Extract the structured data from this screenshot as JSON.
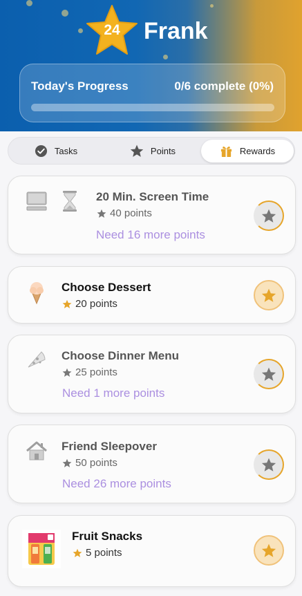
{
  "profile": {
    "level": "24",
    "name": "Frank"
  },
  "progress": {
    "label": "Today's Progress",
    "count_text": "0/6 complete (0%)",
    "fraction": 0
  },
  "tabs": [
    {
      "label": "Tasks",
      "icon": "check-circle-icon"
    },
    {
      "label": "Points",
      "icon": "star-icon"
    },
    {
      "label": "Rewards",
      "icon": "gift-icon",
      "active": true
    }
  ],
  "rewards": [
    {
      "title": "20 Min. Screen Time",
      "points": "40 points",
      "need": "Need 16 more points",
      "icons": [
        "computer-icon",
        "hourglass-icon"
      ],
      "locked": true
    },
    {
      "title": "Choose Dessert",
      "points": "20 points",
      "need": "",
      "icons": [
        "ice-cream-icon"
      ],
      "locked": false
    },
    {
      "title": "Choose Dinner Menu",
      "points": "25 points",
      "need": "Need 1 more points",
      "icons": [
        "pizza-icon"
      ],
      "locked": true
    },
    {
      "title": "Friend Sleepover",
      "points": "50 points",
      "need": "Need 26 more points",
      "icons": [
        "house-icon"
      ],
      "locked": true
    },
    {
      "title": "Fruit Snacks",
      "points": "5 points",
      "need": "",
      "icons": [
        "fruit-snacks-box-image"
      ],
      "locked": false
    }
  ],
  "colors": {
    "accent_gold": "#e6a52a",
    "need_text": "#ab8fe0",
    "header_blue": "#0b5fae"
  }
}
